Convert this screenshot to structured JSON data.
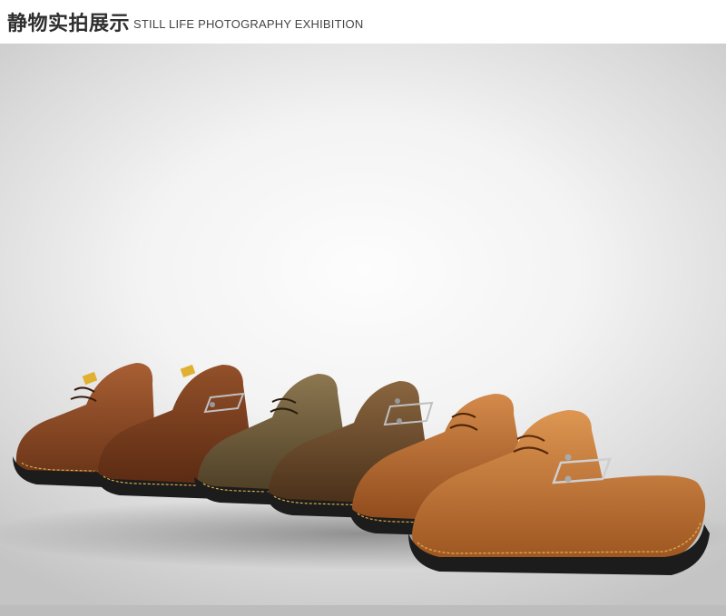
{
  "header": {
    "title_cn": "静物实拍展示",
    "title_en": "STILL LIFE PHOTOGRAPHY EXHIBITION"
  },
  "photo": {
    "subject": "row of six leather lace-up casual shoes",
    "colors": {
      "shoe_1": "#8a4a24",
      "shoe_2": "#7a3c1d",
      "shoe_3": "#6f5a38",
      "shoe_4": "#6b4a2a",
      "shoe_5": "#b8692c",
      "shoe_6": "#c47a34",
      "sole": "#1c1c1c",
      "stitch": "#d9a94a"
    }
  }
}
